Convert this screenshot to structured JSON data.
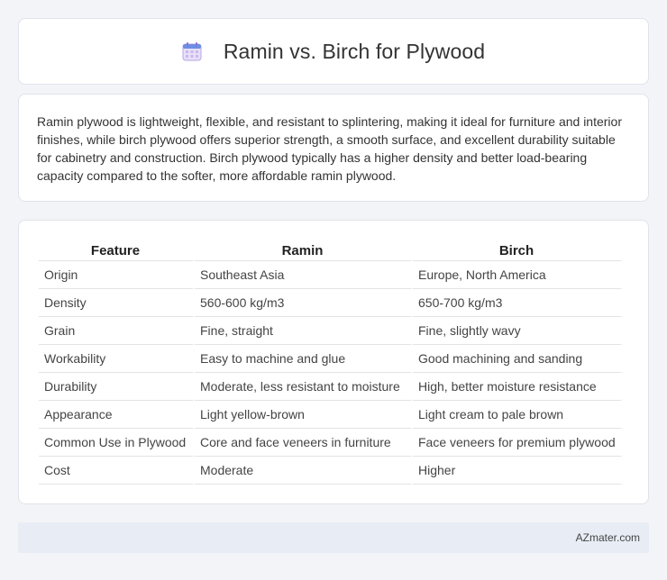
{
  "header": {
    "title": "Ramin vs. Birch for Plywood",
    "icon": "calendar-icon"
  },
  "summary": {
    "text": "Ramin plywood is lightweight, flexible, and resistant to splintering, making it ideal for furniture and interior finishes, while birch plywood offers superior strength, a smooth surface, and excellent durability suitable for cabinetry and construction. Birch plywood typically has a higher density and better load-bearing capacity compared to the softer, more affordable ramin plywood."
  },
  "table": {
    "headers": [
      "Feature",
      "Ramin",
      "Birch"
    ],
    "rows": [
      [
        "Origin",
        "Southeast Asia",
        "Europe, North America"
      ],
      [
        "Density",
        "560-600 kg/m3",
        "650-700 kg/m3"
      ],
      [
        "Grain",
        "Fine, straight",
        "Fine, slightly wavy"
      ],
      [
        "Workability",
        "Easy to machine and glue",
        "Good machining and sanding"
      ],
      [
        "Durability",
        "Moderate, less resistant to moisture",
        "High, better moisture resistance"
      ],
      [
        "Appearance",
        "Light yellow-brown",
        "Light cream to pale brown"
      ],
      [
        "Common Use in Plywood",
        "Core and face veneers in furniture",
        "Face veneers for premium plywood"
      ],
      [
        "Cost",
        "Moderate",
        "Higher"
      ]
    ]
  },
  "footer": {
    "brand": "AZmater.com"
  }
}
